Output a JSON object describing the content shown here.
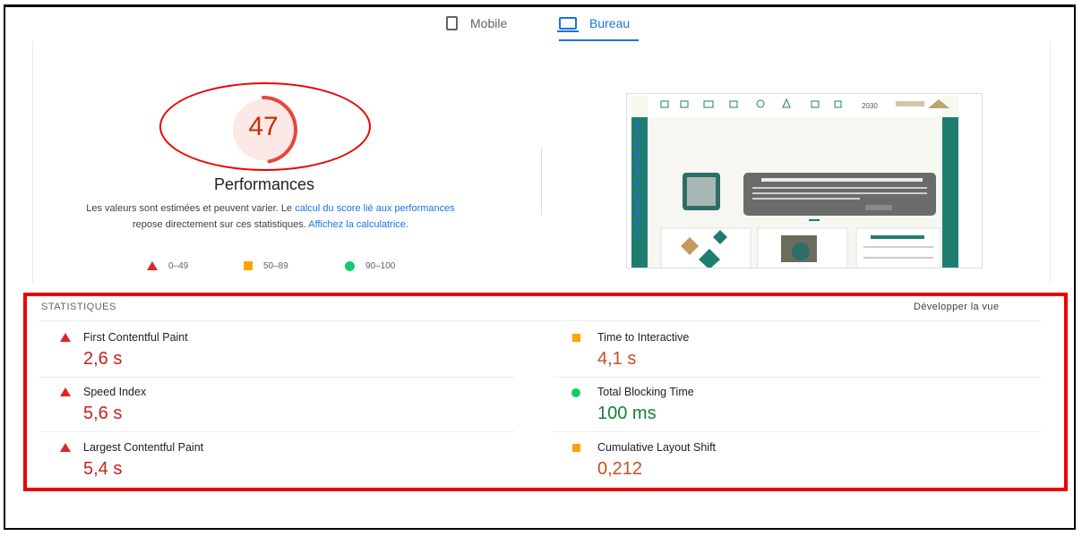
{
  "tabs": {
    "mobile": "Mobile",
    "bureau": "Bureau",
    "active": "Bureau"
  },
  "score": {
    "value": "47",
    "title": "Performances",
    "desc_prefix": "Les valeurs sont estimées et peuvent varier. Le",
    "link1": "calcul du score lié aux performances",
    "desc_mid": "repose directement sur ces statistiques.",
    "link2": "Affichez la calculatrice",
    "desc_end": "."
  },
  "legend": {
    "poor": "0–49",
    "average": "50–89",
    "good": "90–100"
  },
  "colors": {
    "accent": "#1a73e8",
    "poor": "#e02525",
    "average": "#ffa400",
    "good": "#0cce6b",
    "score_text": "#c33300",
    "annotation": "#ee0000"
  },
  "screenshot": {
    "badge": "2030"
  },
  "stats": {
    "label": "STATISTIQUES",
    "expand": "Développer la vue",
    "metrics": [
      {
        "name": "First Contentful Paint",
        "value": "2,6 s",
        "rating": "poor"
      },
      {
        "name": "Speed Index",
        "value": "5,6 s",
        "rating": "poor"
      },
      {
        "name": "Largest Contentful Paint",
        "value": "5,4 s",
        "rating": "poor"
      },
      {
        "name": "Time to Interactive",
        "value": "4,1 s",
        "rating": "average"
      },
      {
        "name": "Total Blocking Time",
        "value": "100 ms",
        "rating": "good"
      },
      {
        "name": "Cumulative Layout Shift",
        "value": "0,212",
        "rating": "average"
      }
    ]
  }
}
